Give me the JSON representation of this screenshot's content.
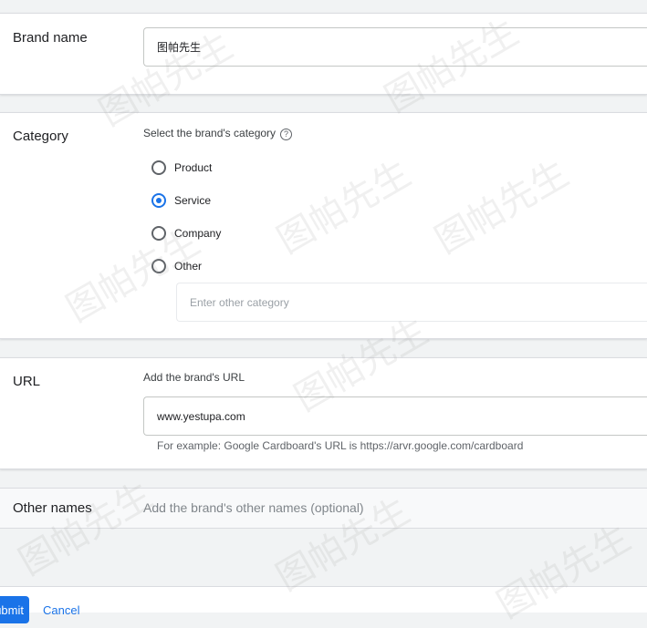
{
  "brand_name": {
    "label": "Brand name",
    "value": "图帕先生"
  },
  "category": {
    "label": "Category",
    "prompt": "Select the brand's category",
    "help_icon": "?",
    "options": [
      "Product",
      "Service",
      "Company",
      "Other"
    ],
    "selected": "Service",
    "other_placeholder": "Enter other category"
  },
  "url": {
    "label": "URL",
    "prompt": "Add the brand's URL",
    "value": "www.yestupa.com",
    "example": "For example: Google Cardboard's URL is https://arvr.google.com/cardboard"
  },
  "other_names": {
    "label": "Other names",
    "placeholder": "Add the brand's other names (optional)"
  },
  "footer": {
    "submit_label": "Submit",
    "cancel_label": "Cancel"
  },
  "watermark": "图帕先生",
  "colors": {
    "accent": "#1a73e8",
    "page_bg": "#f1f3f4",
    "card_bg": "#ffffff",
    "border": "#dadce0"
  }
}
